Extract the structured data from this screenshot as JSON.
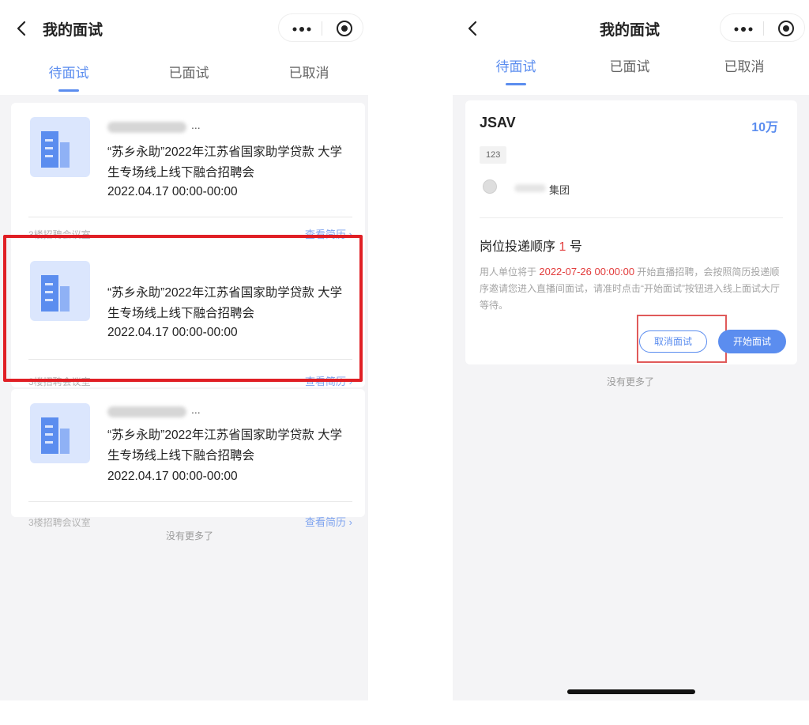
{
  "left": {
    "nav_title": "我的面试",
    "tabs": [
      {
        "label": "待面试",
        "active": true
      },
      {
        "label": "已面试",
        "active": false
      },
      {
        "label": "已取消",
        "active": false
      }
    ],
    "cards": [
      {
        "name_suffix": "...",
        "title": "“苏乡永助”2022年江苏省国家助学贷款 大学生专场线上线下融合招聘会",
        "date": "2022.04.17 00:00-00:00",
        "room": "3楼招聘会议室",
        "link": "查看简历 ›"
      },
      {
        "name_suffix": "",
        "title": "“苏乡永助”2022年江苏省国家助学贷款 大学生专场线上线下融合招聘会",
        "date": "2022.04.17 00:00-00:00",
        "room": "3楼招聘会议室",
        "link": "查看简历 ›"
      },
      {
        "name_suffix": "...",
        "title": "“苏乡永助”2022年江苏省国家助学贷款 大学生专场线上线下融合招聘会",
        "date": "2022.04.17 00:00-00:00",
        "room": "3楼招聘会议室",
        "link": "查看简历 ›"
      }
    ],
    "no_more": "没有更多了"
  },
  "right": {
    "nav_title": "我的面试",
    "tabs": [
      {
        "label": "待面试",
        "active": true
      },
      {
        "label": "已面试",
        "active": false
      },
      {
        "label": "已取消",
        "active": false
      }
    ],
    "job": {
      "title": "JSAV",
      "salary": "10万",
      "tag": "123",
      "company": "集团",
      "order_prefix": "岗位投递顺序",
      "order_num": "1",
      "order_suffix": "号",
      "desc_prefix": "用人单位将于",
      "desc_date": "2022-07-26 00:00:00",
      "desc_suffix": "开始直播招聘，会按照简历投递顺序邀请您进入直播间面试，请准时点击“开始面试”按钮进入线上面试大厅等待。",
      "cancel_label": "取消面试",
      "start_label": "开始面试"
    },
    "no_more": "没有更多了"
  },
  "colors": {
    "accent": "#5b8def",
    "highlight_red": "#e01f25",
    "background": "#f4f4f6"
  }
}
